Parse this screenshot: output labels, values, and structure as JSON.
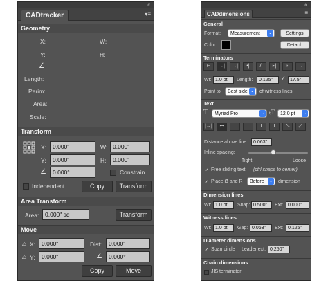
{
  "left_panel": {
    "tab": "CADtracker",
    "menu_icon": "panel-menu-icon",
    "geometry": {
      "title": "Geometry",
      "labels": [
        "X:",
        "Y:",
        "W:",
        "H:",
        "Length:",
        "Perim:",
        "Area:",
        "Scale:"
      ]
    },
    "transform": {
      "title": "Transform",
      "x_label": "X:",
      "x_value": "0.000\"",
      "y_label": "Y:",
      "y_value": "0.000\"",
      "w_label": "W:",
      "w_value": "0.000\"",
      "h_label": "H:",
      "h_value": "0.000\"",
      "angle_value": "0.000°",
      "constrain_label": "Constrain",
      "independent_label": "Independent",
      "copy_label": "Copy",
      "transform_button": "Transform"
    },
    "area_transform": {
      "title": "Area Transform",
      "area_label": "Area:",
      "area_value": "0.000\" sq",
      "transform_button": "Transform"
    },
    "move": {
      "title": "Move",
      "x_label": "X:",
      "x_value": "0.000\"",
      "y_label": "Y:",
      "y_value": "0.000\"",
      "dist_label": "Dist:",
      "dist_value": "0.000\"",
      "angle_value": "0.000°",
      "copy_label": "Copy",
      "move_label": "Move"
    }
  },
  "right_panel": {
    "tab": "CADdimensions",
    "general": {
      "title": "General",
      "format_label": "Format:",
      "format_value": "Measurement",
      "settings_label": "Settings",
      "color_label": "Color:",
      "detach_label": "Detach"
    },
    "terminators": {
      "title": "Terminators",
      "wt_label": "Wt:",
      "wt_value": "1.0 pt",
      "length_label": "Length:",
      "length_value": "0.125\"",
      "angle_value": "17.5°",
      "point_to_label": "Point to",
      "point_to_value": "Best side",
      "witness_label": "of witness lines"
    },
    "text": {
      "title": "Text",
      "font_value": "Myriad Pro",
      "size_value": "12.0 pt",
      "distance_label": "Distance above line:",
      "distance_value": "0.063\"",
      "inline_label": "Inline spacing:",
      "inline_level": 0.42,
      "tight_label": "Tight",
      "loose_label": "Loose",
      "free_label": "Free sliding text",
      "free_hint": "(ctrl snaps to center)",
      "place_label": "Place Ø and R",
      "place_value": "Before",
      "dimension_label": "dimension"
    },
    "dimension_lines": {
      "title": "Dimension lines",
      "wt_label": "Wt:",
      "wt_value": "1.0 pt",
      "snap_label": "Snap:",
      "snap_value": "0.500\"",
      "ext_label": "Ext:",
      "ext_value": "0.000\""
    },
    "witness_lines": {
      "title": "Witness lines",
      "wt_label": "Wt:",
      "wt_value": "1.0 pt",
      "gap_label": "Gap:",
      "gap_value": "0.063\"",
      "ext_label": "Ext:",
      "ext_value": "0.125\""
    },
    "diameter_dimensions": {
      "title": "Diameter dimensions",
      "span_label": "Span circle",
      "leader_label": "Leader ext:",
      "leader_value": "0.250\""
    },
    "chain_dimensions": {
      "title": "Chain dimensions",
      "jis_label": "JIS terminator"
    }
  },
  "colors": {
    "panel_bg": "#535353",
    "field_bg": "#c8c8c8",
    "accent": "#3d7ef0",
    "swatch": "#000000"
  }
}
